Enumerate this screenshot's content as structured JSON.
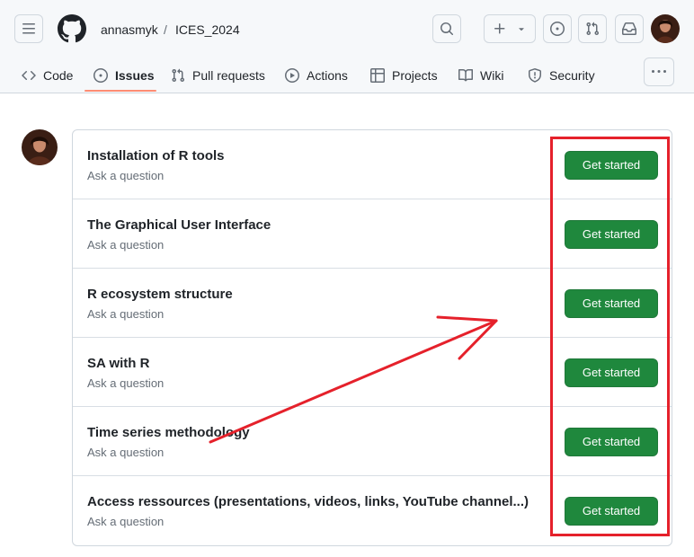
{
  "header": {
    "owner": "annasmyk",
    "separator": "/",
    "repo": "ICES_2024",
    "icons": {
      "menu": "hamburger-menu-icon",
      "logo": "github-logo",
      "search": "search-icon",
      "new": "plus-icon",
      "issues": "issue-opened-icon",
      "pulls": "git-pull-request-icon",
      "inbox": "inbox-icon"
    }
  },
  "tabs": [
    {
      "label": "Code",
      "icon": "code-icon"
    },
    {
      "label": "Issues",
      "icon": "issue-opened-icon",
      "active": true
    },
    {
      "label": "Pull requests",
      "icon": "git-pull-request-icon"
    },
    {
      "label": "Actions",
      "icon": "play-icon"
    },
    {
      "label": "Projects",
      "icon": "table-icon"
    },
    {
      "label": "Wiki",
      "icon": "book-icon"
    },
    {
      "label": "Security",
      "icon": "shield-icon"
    }
  ],
  "templates": [
    {
      "title": "Installation of R tools",
      "subtitle": "Ask a question",
      "button": "Get started"
    },
    {
      "title": "The Graphical User Interface",
      "subtitle": "Ask a question",
      "button": "Get started"
    },
    {
      "title": "R ecosystem structure",
      "subtitle": "Ask a question",
      "button": "Get started"
    },
    {
      "title": "SA with R",
      "subtitle": "Ask a question",
      "button": "Get started"
    },
    {
      "title": "Time series methodology",
      "subtitle": "Ask a question",
      "button": "Get started"
    },
    {
      "title": "Access ressources (presentations, videos, links, YouTube channel...)",
      "subtitle": "Ask a question",
      "button": "Get started"
    }
  ],
  "colors": {
    "accent_green": "#1f883d",
    "active_tab_underline": "#fd8c73",
    "annotation_red": "#e5212b"
  }
}
